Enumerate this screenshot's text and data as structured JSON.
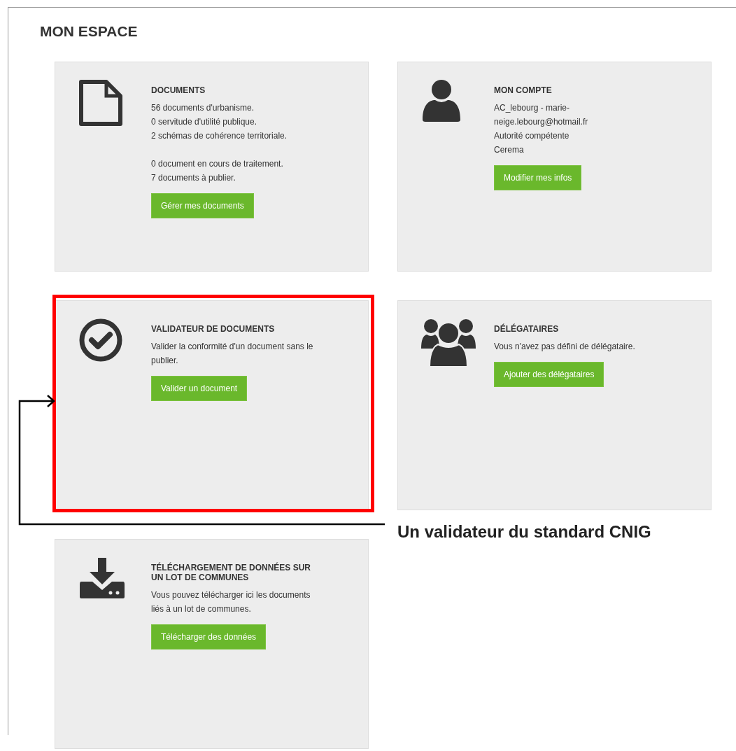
{
  "page": {
    "title": "MON ESPACE"
  },
  "cards": [
    {
      "title": "DOCUMENTS",
      "paragraphs": [
        "56 documents d'urbanisme.\n0 servitude d'utilité publique.\n2 schémas de cohérence territoriale.",
        "0 document en cours de traitement.\n7 documents à publier."
      ],
      "button": "Gérer mes documents",
      "highlighted": false
    },
    {
      "title": "MON COMPTE",
      "paragraphs": [
        "AC_lebourg - marie-\nneige.lebourg@hotmail.fr\nAutorité compétente\nCerema"
      ],
      "button": "Modifier mes infos",
      "highlighted": false
    },
    {
      "title": "VALIDATEUR DE DOCUMENTS",
      "paragraphs": [
        "Valider la conformité d'un document sans le\npublier."
      ],
      "button": "Valider un document",
      "highlighted": true
    },
    {
      "title": "DÉLÉGATAIRES",
      "paragraphs": [
        "Vous n'avez pas défini de délégataire."
      ],
      "button": "Ajouter des délégataires",
      "highlighted": false
    },
    {
      "title": "TÉLÉCHARGEMENT DE DONNÉES SUR\nUN LOT DE COMMUNES",
      "paragraphs": [
        "Vous pouvez télécharger ici les documents\nliés à un lot de communes."
      ],
      "button": "Télécharger des données",
      "highlighted": false
    }
  ],
  "annotation": {
    "label": "Un validateur du standard CNIG"
  }
}
